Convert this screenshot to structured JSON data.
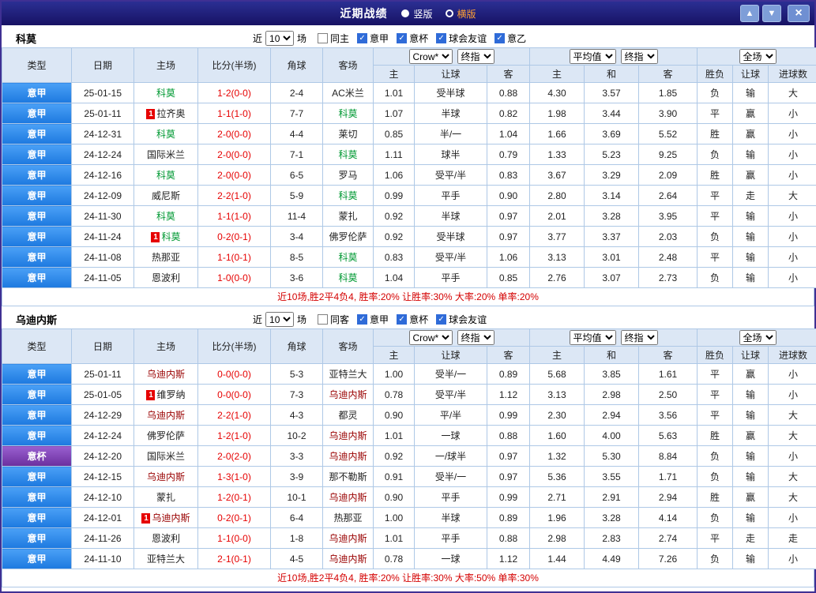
{
  "colors": {
    "league_blue": "#1d79df",
    "cup_purple": "#6a2f9e",
    "score_red": "#e60000",
    "win_red": "#e60000",
    "lose_blue": "#2244cc",
    "push_orange": "#ff7518",
    "como_green": "#009933",
    "udinese_maroon": "#990000",
    "titlebar_navy": "#171264",
    "header_lightblue": "#dce7f5"
  },
  "titlebar": {
    "title": "近期战绩",
    "view_options": [
      {
        "label": "竖版",
        "selected": true
      },
      {
        "label": "横版",
        "selected": false
      }
    ],
    "buttons": {
      "up": "▲",
      "down": "▼",
      "close": "×"
    }
  },
  "table_header": {
    "fixed_cols": [
      "类型",
      "日期",
      "主场",
      "比分(半场)",
      "角球",
      "客场"
    ],
    "odds_sub": [
      "主",
      "让球",
      "客"
    ],
    "avg_sub": [
      "主",
      "和",
      "客"
    ],
    "result_sub": [
      "胜负",
      "让球",
      "进球数"
    ]
  },
  "sections": [
    {
      "team": "科莫",
      "near_label": "近",
      "count": "10",
      "matches_label": "场",
      "filters": [
        {
          "label": "同主",
          "checked": false
        },
        {
          "label": "意甲",
          "checked": true
        },
        {
          "label": "意杯",
          "checked": true
        },
        {
          "label": "球会友谊",
          "checked": true
        },
        {
          "label": "意乙",
          "checked": true
        }
      ],
      "selects": {
        "book": "Crow*",
        "book_stage": "终指",
        "avg": "平均值",
        "avg_stage": "终指",
        "scope": "全场"
      },
      "rows": [
        {
          "type": "意甲",
          "type_kind": "league",
          "date": "25-01-15",
          "home": {
            "name": "科莫",
            "color": "green",
            "badge": ""
          },
          "score": "1-2(0-0)",
          "corner": "2-4",
          "away": {
            "name": "AC米兰",
            "color": "black"
          },
          "odds": [
            "1.01",
            "受半球",
            "0.88"
          ],
          "avg": [
            "4.30",
            "3.57",
            "1.85"
          ],
          "results": [
            {
              "t": "负",
              "c": "blue"
            },
            {
              "t": "输",
              "c": "blue"
            },
            {
              "t": "大",
              "c": "red"
            }
          ]
        },
        {
          "type": "意甲",
          "type_kind": "league",
          "date": "25-01-11",
          "home": {
            "name": "拉齐奥",
            "color": "black",
            "badge": "1"
          },
          "score": "1-1(1-0)",
          "corner": "7-7",
          "away": {
            "name": "科莫",
            "color": "green"
          },
          "odds": [
            "1.07",
            "半球",
            "0.82"
          ],
          "avg": [
            "1.98",
            "3.44",
            "3.90"
          ],
          "results": [
            {
              "t": "平",
              "c": "blue"
            },
            {
              "t": "赢",
              "c": "red"
            },
            {
              "t": "小",
              "c": "blue"
            }
          ]
        },
        {
          "type": "意甲",
          "type_kind": "league",
          "date": "24-12-31",
          "home": {
            "name": "科莫",
            "color": "green",
            "badge": ""
          },
          "score": "2-0(0-0)",
          "corner": "4-4",
          "away": {
            "name": "莱切",
            "color": "black"
          },
          "odds": [
            "0.85",
            "半/一",
            "1.04"
          ],
          "avg": [
            "1.66",
            "3.69",
            "5.52"
          ],
          "results": [
            {
              "t": "胜",
              "c": "red"
            },
            {
              "t": "赢",
              "c": "red"
            },
            {
              "t": "小",
              "c": "blue"
            }
          ]
        },
        {
          "type": "意甲",
          "type_kind": "league",
          "date": "24-12-24",
          "home": {
            "name": "国际米兰",
            "color": "black",
            "badge": ""
          },
          "score": "2-0(0-0)",
          "corner": "7-1",
          "away": {
            "name": "科莫",
            "color": "green"
          },
          "odds": [
            "1.11",
            "球半",
            "0.79"
          ],
          "avg": [
            "1.33",
            "5.23",
            "9.25"
          ],
          "results": [
            {
              "t": "负",
              "c": "blue"
            },
            {
              "t": "输",
              "c": "blue"
            },
            {
              "t": "小",
              "c": "blue"
            }
          ]
        },
        {
          "type": "意甲",
          "type_kind": "league",
          "date": "24-12-16",
          "home": {
            "name": "科莫",
            "color": "green",
            "badge": ""
          },
          "score": "2-0(0-0)",
          "corner": "6-5",
          "away": {
            "name": "罗马",
            "color": "black"
          },
          "odds": [
            "1.06",
            "受平/半",
            "0.83"
          ],
          "avg": [
            "3.67",
            "3.29",
            "2.09"
          ],
          "results": [
            {
              "t": "胜",
              "c": "red"
            },
            {
              "t": "赢",
              "c": "red"
            },
            {
              "t": "小",
              "c": "blue"
            }
          ]
        },
        {
          "type": "意甲",
          "type_kind": "league",
          "date": "24-12-09",
          "home": {
            "name": "威尼斯",
            "color": "black",
            "badge": ""
          },
          "score": "2-2(1-0)",
          "corner": "5-9",
          "away": {
            "name": "科莫",
            "color": "green"
          },
          "odds": [
            "0.99",
            "平手",
            "0.90"
          ],
          "avg": [
            "2.80",
            "3.14",
            "2.64"
          ],
          "results": [
            {
              "t": "平",
              "c": "blue"
            },
            {
              "t": "走",
              "c": "orange"
            },
            {
              "t": "大",
              "c": "red"
            }
          ]
        },
        {
          "type": "意甲",
          "type_kind": "league",
          "date": "24-11-30",
          "home": {
            "name": "科莫",
            "color": "green",
            "badge": ""
          },
          "score": "1-1(1-0)",
          "corner": "11-4",
          "away": {
            "name": "蒙扎",
            "color": "black"
          },
          "odds": [
            "0.92",
            "半球",
            "0.97"
          ],
          "avg": [
            "2.01",
            "3.28",
            "3.95"
          ],
          "results": [
            {
              "t": "平",
              "c": "blue"
            },
            {
              "t": "输",
              "c": "blue"
            },
            {
              "t": "小",
              "c": "blue"
            }
          ]
        },
        {
          "type": "意甲",
          "type_kind": "league",
          "date": "24-11-24",
          "home": {
            "name": "科莫",
            "color": "green",
            "badge": "1"
          },
          "score": "0-2(0-1)",
          "corner": "3-4",
          "away": {
            "name": "佛罗伦萨",
            "color": "black"
          },
          "odds": [
            "0.92",
            "受半球",
            "0.97"
          ],
          "avg": [
            "3.77",
            "3.37",
            "2.03"
          ],
          "results": [
            {
              "t": "负",
              "c": "blue"
            },
            {
              "t": "输",
              "c": "blue"
            },
            {
              "t": "小",
              "c": "blue"
            }
          ]
        },
        {
          "type": "意甲",
          "type_kind": "league",
          "date": "24-11-08",
          "home": {
            "name": "热那亚",
            "color": "black",
            "badge": ""
          },
          "score": "1-1(0-1)",
          "corner": "8-5",
          "away": {
            "name": "科莫",
            "color": "green"
          },
          "odds": [
            "0.83",
            "受平/半",
            "1.06"
          ],
          "avg": [
            "3.13",
            "3.01",
            "2.48"
          ],
          "results": [
            {
              "t": "平",
              "c": "blue"
            },
            {
              "t": "输",
              "c": "blue"
            },
            {
              "t": "小",
              "c": "blue"
            }
          ]
        },
        {
          "type": "意甲",
          "type_kind": "league",
          "date": "24-11-05",
          "home": {
            "name": "恩波利",
            "color": "black",
            "badge": ""
          },
          "score": "1-0(0-0)",
          "corner": "3-6",
          "away": {
            "name": "科莫",
            "color": "green"
          },
          "odds": [
            "1.04",
            "平手",
            "0.85"
          ],
          "avg": [
            "2.76",
            "3.07",
            "2.73"
          ],
          "results": [
            {
              "t": "负",
              "c": "blue"
            },
            {
              "t": "输",
              "c": "blue"
            },
            {
              "t": "小",
              "c": "blue"
            }
          ]
        }
      ],
      "footer": "近10场,胜2平4负4, 胜率:20% 让胜率:30% 大率:20% 单率:20%"
    },
    {
      "team": "乌迪内斯",
      "near_label": "近",
      "count": "10",
      "matches_label": "场",
      "filters": [
        {
          "label": "同客",
          "checked": false
        },
        {
          "label": "意甲",
          "checked": true
        },
        {
          "label": "意杯",
          "checked": true
        },
        {
          "label": "球会友谊",
          "checked": true
        }
      ],
      "selects": {
        "book": "Crow*",
        "book_stage": "终指",
        "avg": "平均值",
        "avg_stage": "终指",
        "scope": "全场"
      },
      "rows": [
        {
          "type": "意甲",
          "type_kind": "league",
          "date": "25-01-11",
          "home": {
            "name": "乌迪内斯",
            "color": "maroon",
            "badge": ""
          },
          "score": "0-0(0-0)",
          "corner": "5-3",
          "away": {
            "name": "亚特兰大",
            "color": "black"
          },
          "odds": [
            "1.00",
            "受半/一",
            "0.89"
          ],
          "avg": [
            "5.68",
            "3.85",
            "1.61"
          ],
          "results": [
            {
              "t": "平",
              "c": "blue"
            },
            {
              "t": "赢",
              "c": "red"
            },
            {
              "t": "小",
              "c": "blue"
            }
          ]
        },
        {
          "type": "意甲",
          "type_kind": "league",
          "date": "25-01-05",
          "home": {
            "name": "维罗纳",
            "color": "black",
            "badge": "1"
          },
          "score": "0-0(0-0)",
          "corner": "7-3",
          "away": {
            "name": "乌迪内斯",
            "color": "maroon"
          },
          "odds": [
            "0.78",
            "受平/半",
            "1.12"
          ],
          "avg": [
            "3.13",
            "2.98",
            "2.50"
          ],
          "results": [
            {
              "t": "平",
              "c": "blue"
            },
            {
              "t": "输",
              "c": "blue"
            },
            {
              "t": "小",
              "c": "blue"
            }
          ]
        },
        {
          "type": "意甲",
          "type_kind": "league",
          "date": "24-12-29",
          "home": {
            "name": "乌迪内斯",
            "color": "maroon",
            "badge": ""
          },
          "score": "2-2(1-0)",
          "corner": "4-3",
          "away": {
            "name": "都灵",
            "color": "black"
          },
          "odds": [
            "0.90",
            "平/半",
            "0.99"
          ],
          "avg": [
            "2.30",
            "2.94",
            "3.56"
          ],
          "results": [
            {
              "t": "平",
              "c": "blue"
            },
            {
              "t": "输",
              "c": "blue"
            },
            {
              "t": "大",
              "c": "red"
            }
          ]
        },
        {
          "type": "意甲",
          "type_kind": "league",
          "date": "24-12-24",
          "home": {
            "name": "佛罗伦萨",
            "color": "black",
            "badge": ""
          },
          "score": "1-2(1-0)",
          "corner": "10-2",
          "away": {
            "name": "乌迪内斯",
            "color": "maroon"
          },
          "odds": [
            "1.01",
            "一球",
            "0.88"
          ],
          "avg": [
            "1.60",
            "4.00",
            "5.63"
          ],
          "results": [
            {
              "t": "胜",
              "c": "red"
            },
            {
              "t": "赢",
              "c": "red"
            },
            {
              "t": "大",
              "c": "red"
            }
          ]
        },
        {
          "type": "意杯",
          "type_kind": "cup",
          "date": "24-12-20",
          "home": {
            "name": "国际米兰",
            "color": "black",
            "badge": ""
          },
          "score": "2-0(2-0)",
          "corner": "3-3",
          "away": {
            "name": "乌迪内斯",
            "color": "maroon"
          },
          "odds": [
            "0.92",
            "一/球半",
            "0.97"
          ],
          "avg": [
            "1.32",
            "5.30",
            "8.84"
          ],
          "results": [
            {
              "t": "负",
              "c": "blue"
            },
            {
              "t": "输",
              "c": "blue"
            },
            {
              "t": "小",
              "c": "blue"
            }
          ]
        },
        {
          "type": "意甲",
          "type_kind": "league",
          "date": "24-12-15",
          "home": {
            "name": "乌迪内斯",
            "color": "maroon",
            "badge": ""
          },
          "score": "1-3(1-0)",
          "corner": "3-9",
          "away": {
            "name": "那不勒斯",
            "color": "black"
          },
          "odds": [
            "0.91",
            "受半/一",
            "0.97"
          ],
          "avg": [
            "5.36",
            "3.55",
            "1.71"
          ],
          "results": [
            {
              "t": "负",
              "c": "blue"
            },
            {
              "t": "输",
              "c": "blue"
            },
            {
              "t": "大",
              "c": "red"
            }
          ]
        },
        {
          "type": "意甲",
          "type_kind": "league",
          "date": "24-12-10",
          "home": {
            "name": "蒙扎",
            "color": "black",
            "badge": ""
          },
          "score": "1-2(0-1)",
          "corner": "10-1",
          "away": {
            "name": "乌迪内斯",
            "color": "maroon"
          },
          "odds": [
            "0.90",
            "平手",
            "0.99"
          ],
          "avg": [
            "2.71",
            "2.91",
            "2.94"
          ],
          "results": [
            {
              "t": "胜",
              "c": "red"
            },
            {
              "t": "赢",
              "c": "red"
            },
            {
              "t": "大",
              "c": "red"
            }
          ]
        },
        {
          "type": "意甲",
          "type_kind": "league",
          "date": "24-12-01",
          "home": {
            "name": "乌迪内斯",
            "color": "maroon",
            "badge": "1"
          },
          "score": "0-2(0-1)",
          "corner": "6-4",
          "away": {
            "name": "热那亚",
            "color": "black"
          },
          "odds": [
            "1.00",
            "半球",
            "0.89"
          ],
          "avg": [
            "1.96",
            "3.28",
            "4.14"
          ],
          "results": [
            {
              "t": "负",
              "c": "blue"
            },
            {
              "t": "输",
              "c": "blue"
            },
            {
              "t": "小",
              "c": "blue"
            }
          ]
        },
        {
          "type": "意甲",
          "type_kind": "league",
          "date": "24-11-26",
          "home": {
            "name": "恩波利",
            "color": "black",
            "badge": ""
          },
          "score": "1-1(0-0)",
          "corner": "1-8",
          "away": {
            "name": "乌迪内斯",
            "color": "maroon"
          },
          "odds": [
            "1.01",
            "平手",
            "0.88"
          ],
          "avg": [
            "2.98",
            "2.83",
            "2.74"
          ],
          "results": [
            {
              "t": "平",
              "c": "blue"
            },
            {
              "t": "走",
              "c": "orange"
            },
            {
              "t": "走",
              "c": "orange"
            }
          ]
        },
        {
          "type": "意甲",
          "type_kind": "league",
          "date": "24-11-10",
          "home": {
            "name": "亚特兰大",
            "color": "black",
            "badge": ""
          },
          "score": "2-1(0-1)",
          "corner": "4-5",
          "away": {
            "name": "乌迪内斯",
            "color": "maroon"
          },
          "odds": [
            "0.78",
            "一球",
            "1.12"
          ],
          "avg": [
            "1.44",
            "4.49",
            "7.26"
          ],
          "results": [
            {
              "t": "负",
              "c": "blue"
            },
            {
              "t": "输",
              "c": "blue"
            },
            {
              "t": "小",
              "c": "blue"
            }
          ]
        }
      ],
      "footer": "近10场,胜2平4负4, 胜率:20% 让胜率:30% 大率:50% 单率:30%"
    }
  ]
}
